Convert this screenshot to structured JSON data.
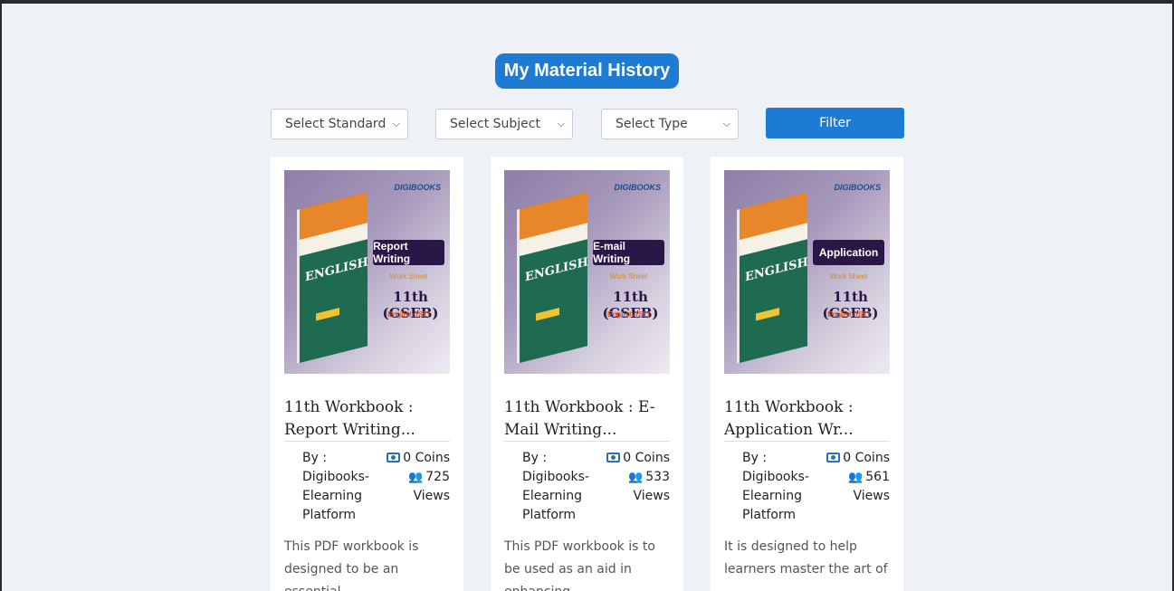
{
  "page": {
    "title": "My Material History"
  },
  "filters": {
    "standard": "Select Standard",
    "subject": "Select Subject",
    "type": "Select Type",
    "button": "Filter"
  },
  "colors": {
    "accent": "#1e7bd4",
    "icon": "#2a6fb8"
  },
  "cards": [
    {
      "thumb_logo": "DIGIBOOKS",
      "thumb_banner": "Report Writing",
      "thumb_worksheet": "Work Sheet",
      "thumb_grade": "11th (GSEB)",
      "thumb_subject": "English (SL)",
      "thumb_book": "ENGLISH",
      "title": "11th Workbook : Report Writing...",
      "by": "By :",
      "author": "Digibooks-Elearning Platform",
      "coins": "0 Coins",
      "views": "725",
      "views_label": "Views",
      "description": "This PDF workbook is designed to be an essential"
    },
    {
      "thumb_logo": "DIGIBOOKS",
      "thumb_banner": "E-mail Writing",
      "thumb_worksheet": "Work Sheet",
      "thumb_grade": "11th (GSEB)",
      "thumb_subject": "English (SL)",
      "thumb_book": "ENGLISH",
      "title": "11th Workbook : E-Mail Writing...",
      "by": "By :",
      "author": "Digibooks-Elearning Platform",
      "coins": "0 Coins",
      "views": "533",
      "views_label": "Views",
      "description": "This PDF workbook is to be used as an aid in enhancing"
    },
    {
      "thumb_logo": "DIGIBOOKS",
      "thumb_banner": "Application",
      "thumb_worksheet": "Work Sheet",
      "thumb_grade": "11th (GSEB)",
      "thumb_subject": "English (SL)",
      "thumb_book": "ENGLISH",
      "title": "11th Workbook : Application Wr...",
      "by": "By :",
      "author": "Digibooks-Elearning Platform",
      "coins": "0 Coins",
      "views": "561",
      "views_label": "Views",
      "description": "It is designed to help learners master the art of"
    }
  ]
}
